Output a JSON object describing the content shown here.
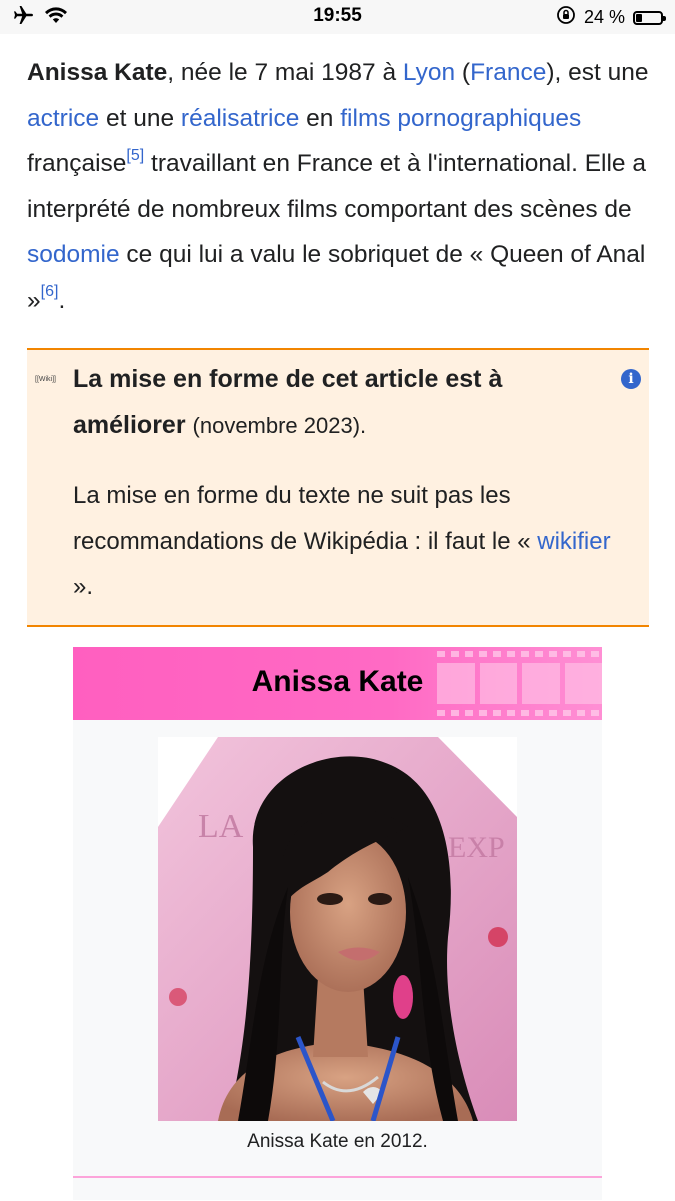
{
  "status_bar": {
    "time": "19:55",
    "battery_label": "24 %",
    "battery_level": 0.24,
    "icons": [
      "airplane-icon",
      "wifi-icon",
      "orientation-lock-icon",
      "battery-icon"
    ]
  },
  "intro": {
    "name": "Anissa Kate",
    "t1": ", née le 7 mai 1987 à ",
    "lyon": "Lyon",
    "t2": " (",
    "france": "France",
    "t3": "), est une ",
    "actrice": "actrice",
    "t4": " et une ",
    "realisatrice": "réalisatrice",
    "t5": " en ",
    "films": "films pornographiques",
    "t6": " française",
    "ref5": "[5]",
    "t7": " travaillant en France et à l'international. Elle a interprété de nombreux films comportant des scènes de ",
    "sodomie": "sodomie",
    "t8": " ce qui lui a valu le sobriquet de « Queen of Anal »",
    "ref6": "[6]",
    "t9": "."
  },
  "maintenance_box": {
    "image_alt": "[[Wiki]]",
    "title": "La mise en forme de cet article est à améliorer",
    "date": "(novembre 2023).",
    "body1": "La mise en forme du texte ne suit pas les recommandations de Wikipédia : il faut le « ",
    "link": "wikifier",
    "body2": " ».",
    "accent_color": "#f28500",
    "background_color": "#fff1e1"
  },
  "infobox": {
    "title": "Anissa Kate",
    "caption": "Anissa Kate en 2012.",
    "header_color": "#ff5fc0"
  }
}
